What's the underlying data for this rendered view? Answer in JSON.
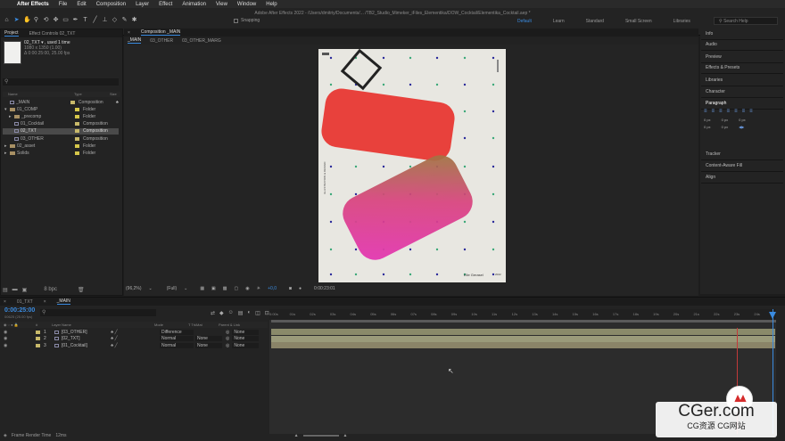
{
  "menu": {
    "app": "After Effects",
    "items": [
      "File",
      "Edit",
      "Composition",
      "Layer",
      "Effect",
      "Animation",
      "View",
      "Window",
      "Help"
    ]
  },
  "window_title": "Adobe After Effects 2022 - /Users/dmitriy/Documents/... /TB2_Studio_Mimeker_iFiles_Elementika/DOW_Cocktail/Elementika_Cocktail.aep *",
  "toolbar": {
    "snapping_label": "Snapping",
    "workspaces": [
      "Default",
      "Learn",
      "Standard",
      "Small Screen",
      "Libraries"
    ],
    "active_workspace": "Default",
    "search_placeholder": "Search Help"
  },
  "project_panel": {
    "tab_project": "Project",
    "tab_effect_controls": "Effect Controls 02_TXT",
    "selected_name": "02_TXT ▾ , used 1 time",
    "info_line1": "1080 x 1350 (1.00)",
    "info_line2": "Δ 0:00:25:00, 25.00 fps",
    "col_name": "Name",
    "col_type": "Type",
    "col_size": "Size",
    "rows": [
      {
        "name": "_MAIN",
        "type": "Composition",
        "kind": "comp",
        "color": "#c8b96a",
        "indent": 0,
        "selected": false,
        "arrow": ""
      },
      {
        "name": "01_COMP",
        "type": "Folder",
        "kind": "folder",
        "color": "#d6c74a",
        "indent": 0,
        "selected": false,
        "arrow": "▾"
      },
      {
        "name": "_precomp",
        "type": "Folder",
        "kind": "folder",
        "color": "#d6c74a",
        "indent": 1,
        "selected": false,
        "arrow": "▸"
      },
      {
        "name": "01_Cocktail",
        "type": "Composition",
        "kind": "comp",
        "color": "#c8b96a",
        "indent": 1,
        "selected": false,
        "arrow": ""
      },
      {
        "name": "02_TXT",
        "type": "Composition",
        "kind": "comp",
        "color": "#c8b96a",
        "indent": 1,
        "selected": true,
        "arrow": ""
      },
      {
        "name": "03_OTHER",
        "type": "Composition",
        "kind": "comp",
        "color": "#c8b96a",
        "indent": 1,
        "selected": false,
        "arrow": ""
      },
      {
        "name": "02_asset",
        "type": "Folder",
        "kind": "folder",
        "color": "#d6c74a",
        "indent": 0,
        "selected": false,
        "arrow": "▸"
      },
      {
        "name": "Solids",
        "type": "Folder",
        "kind": "folder",
        "color": "#d6c74a",
        "indent": 0,
        "selected": false,
        "arrow": "▸"
      }
    ],
    "bpc": "8 bpc"
  },
  "viewer": {
    "tab_label": "Composition _MAIN",
    "nav": [
      "_MAIN",
      "03_OTHER",
      "03_OTHER_MARG"
    ],
    "zoom": "(96,2%)",
    "resolution": "(Full)",
    "exposure": "+0,0",
    "timecode": "0:00:23:01",
    "poster_vertical_text": "ILLUSTRATION & DESIGN",
    "poster_credit": "Elle Gerasel",
    "poster_corner": "2022"
  },
  "right_panel": {
    "items": [
      "Info",
      "Audio",
      "Preview",
      "Effects & Presets",
      "Libraries",
      "Character",
      "Paragraph",
      "Tracker",
      "Content-Aware Fill",
      "Align"
    ],
    "para_values": [
      "0 px",
      "0 px",
      "0 px",
      "0 px",
      "0 px"
    ]
  },
  "timeline": {
    "tabs": [
      "01_TXT",
      "_MAIN"
    ],
    "timecode": "0:00:25:00",
    "timecode_sub": "00625 (25.00 fps)",
    "headers": [
      "#",
      "Layer Name",
      "Mode",
      "T TrkMat",
      "Parent & Link"
    ],
    "layers": [
      {
        "num": "1",
        "name": "[03_OTHER]",
        "mode": "Difference",
        "trkmat": "",
        "parent": "None",
        "bar_color": "#8a8a6a"
      },
      {
        "num": "2",
        "name": "[02_TXT]",
        "mode": "Normal",
        "trkmat": "None",
        "parent": "None",
        "bar_color": "#9a9a7a"
      },
      {
        "num": "3",
        "name": "[01_Cocktail]",
        "mode": "Normal",
        "trkmat": "None",
        "parent": "None",
        "bar_color": "#8a8468"
      }
    ],
    "ruler_ticks": [
      "0:00s",
      "01s",
      "02s",
      "03s",
      "04s",
      "05s",
      "06s",
      "07s",
      "08s",
      "09s",
      "10s",
      "11s",
      "12s",
      "13s",
      "14s",
      "15s",
      "16s",
      "17s",
      "18s",
      "19s",
      "20s",
      "21s",
      "22s",
      "23s",
      "24s"
    ],
    "frame_render_label": "Frame Render Time",
    "frame_render_value": "12ms"
  },
  "watermark": {
    "big": "CGer.com",
    "small": "CG资源 CG网站"
  },
  "colors": {
    "accent": "#3a8be0",
    "red_shape": "#e8413c",
    "pink_shape": "#e33cb0",
    "canvas_bg": "#e8e7e1"
  }
}
